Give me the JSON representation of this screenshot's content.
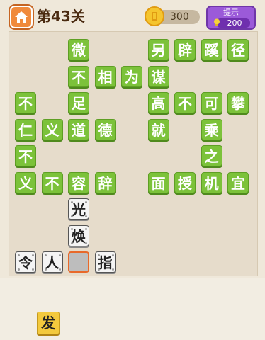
{
  "header": {
    "level": "第43关",
    "coins": "300",
    "hint_label": "提示",
    "hint_cost": "200"
  },
  "icons": {
    "home": "home-icon",
    "coin": "coin-icon",
    "bulb": "lightbulb-icon"
  },
  "colors": {
    "green_tile": "#7cc23a",
    "white_tile": "#f4f4f4",
    "empty_border": "#e8692a",
    "choice_tile": "#f3c93d",
    "hint_button": "#9b5ad9",
    "home_button": "#f08a3c"
  },
  "grid": {
    "green": [
      {
        "ch": "微",
        "r": 0,
        "c": 2
      },
      {
        "ch": "另",
        "r": 0,
        "c": 5
      },
      {
        "ch": "辟",
        "r": 0,
        "c": 6
      },
      {
        "ch": "蹊",
        "r": 0,
        "c": 7
      },
      {
        "ch": "径",
        "r": 0,
        "c": 8
      },
      {
        "ch": "不",
        "r": 1,
        "c": 2
      },
      {
        "ch": "相",
        "r": 1,
        "c": 3
      },
      {
        "ch": "为",
        "r": 1,
        "c": 4
      },
      {
        "ch": "谋",
        "r": 1,
        "c": 5
      },
      {
        "ch": "不",
        "r": 2,
        "c": 0
      },
      {
        "ch": "足",
        "r": 2,
        "c": 2
      },
      {
        "ch": "高",
        "r": 2,
        "c": 5
      },
      {
        "ch": "不",
        "r": 2,
        "c": 6
      },
      {
        "ch": "可",
        "r": 2,
        "c": 7
      },
      {
        "ch": "攀",
        "r": 2,
        "c": 8
      },
      {
        "ch": "仁",
        "r": 3,
        "c": 0
      },
      {
        "ch": "义",
        "r": 3,
        "c": 1
      },
      {
        "ch": "道",
        "r": 3,
        "c": 2
      },
      {
        "ch": "德",
        "r": 3,
        "c": 3
      },
      {
        "ch": "就",
        "r": 3,
        "c": 5
      },
      {
        "ch": "乘",
        "r": 3,
        "c": 7
      },
      {
        "ch": "不",
        "r": 4,
        "c": 0
      },
      {
        "ch": "之",
        "r": 4,
        "c": 7
      },
      {
        "ch": "义",
        "r": 5,
        "c": 0
      },
      {
        "ch": "不",
        "r": 5,
        "c": 1
      },
      {
        "ch": "容",
        "r": 5,
        "c": 2
      },
      {
        "ch": "辞",
        "r": 5,
        "c": 3
      },
      {
        "ch": "面",
        "r": 5,
        "c": 5
      },
      {
        "ch": "授",
        "r": 5,
        "c": 6
      },
      {
        "ch": "机",
        "r": 5,
        "c": 7
      },
      {
        "ch": "宜",
        "r": 5,
        "c": 8
      }
    ],
    "white": [
      {
        "ch": "光",
        "r": 6,
        "c": 2
      },
      {
        "ch": "焕",
        "r": 7,
        "c": 2
      },
      {
        "ch": "令",
        "r": 8,
        "c": 0
      },
      {
        "ch": "人",
        "r": 8,
        "c": 1
      },
      {
        "ch": "指",
        "r": 8,
        "c": 3
      }
    ],
    "empty": [
      {
        "r": 8,
        "c": 2
      }
    ]
  },
  "choices": [
    "发"
  ]
}
